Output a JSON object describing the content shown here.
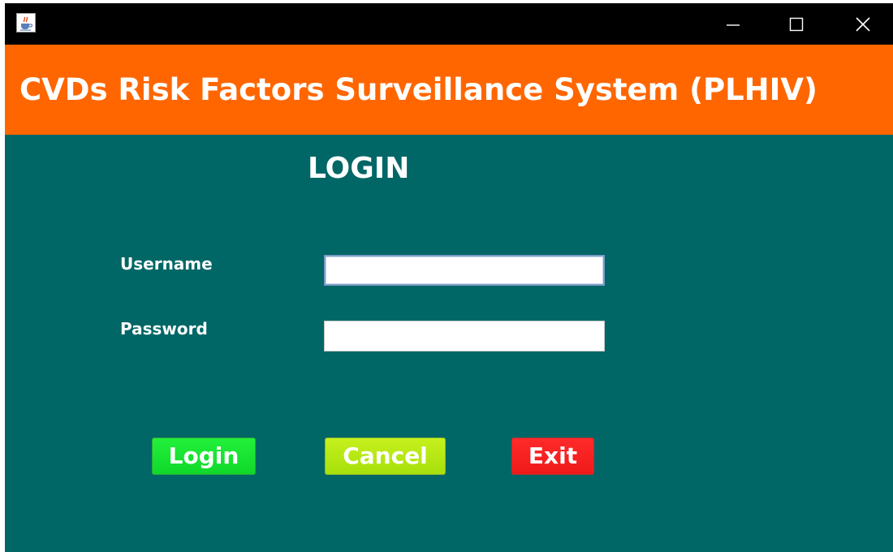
{
  "window": {
    "icon": "java-cup-icon",
    "controls": {
      "minimize_icon": "minimize-icon",
      "maximize_icon": "maximize-icon",
      "close_icon": "close-icon"
    }
  },
  "header": {
    "title": "CVDs Risk Factors Surveillance System (PLHIV)"
  },
  "login": {
    "heading": "LOGIN",
    "username_label": "Username",
    "username_value": "",
    "password_label": "Password",
    "password_value": ""
  },
  "buttons": {
    "login_label": "Login",
    "cancel_label": "Cancel",
    "exit_label": "Exit"
  },
  "colors": {
    "titlebar": "#000000",
    "header": "#ff6600",
    "body": "#006666",
    "login_button": "#18e030",
    "cancel_button": "#b4e814",
    "exit_button": "#f42020",
    "text": "#ffffff"
  }
}
